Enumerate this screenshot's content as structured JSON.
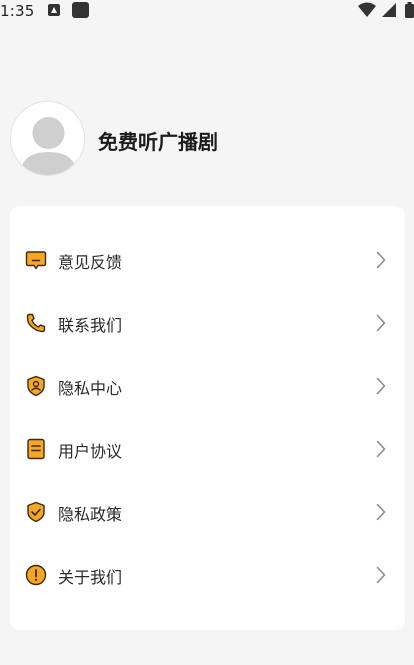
{
  "status_bar": {
    "time": "1:35",
    "left_icons": [
      "notification-a-icon",
      "square-app-icon"
    ],
    "right_icons": [
      "wifi-icon",
      "cell-signal-icon",
      "battery-icon"
    ]
  },
  "profile": {
    "avatar_icon": "default-user-avatar-icon",
    "app_name": "免费听广播剧"
  },
  "colors": {
    "accent": "#f5a623",
    "icon_stroke": "#3a2a14",
    "background": "#f5f5f5",
    "card": "#ffffff"
  },
  "menu": {
    "items": [
      {
        "label": "意见反馈",
        "icon": "feedback-chat-icon"
      },
      {
        "label": "联系我们",
        "icon": "phone-icon"
      },
      {
        "label": "隐私中心",
        "icon": "shield-user-icon"
      },
      {
        "label": "用户协议",
        "icon": "document-icon"
      },
      {
        "label": "隐私政策",
        "icon": "shield-check-icon"
      },
      {
        "label": "关于我们",
        "icon": "info-circle-icon"
      }
    ]
  }
}
